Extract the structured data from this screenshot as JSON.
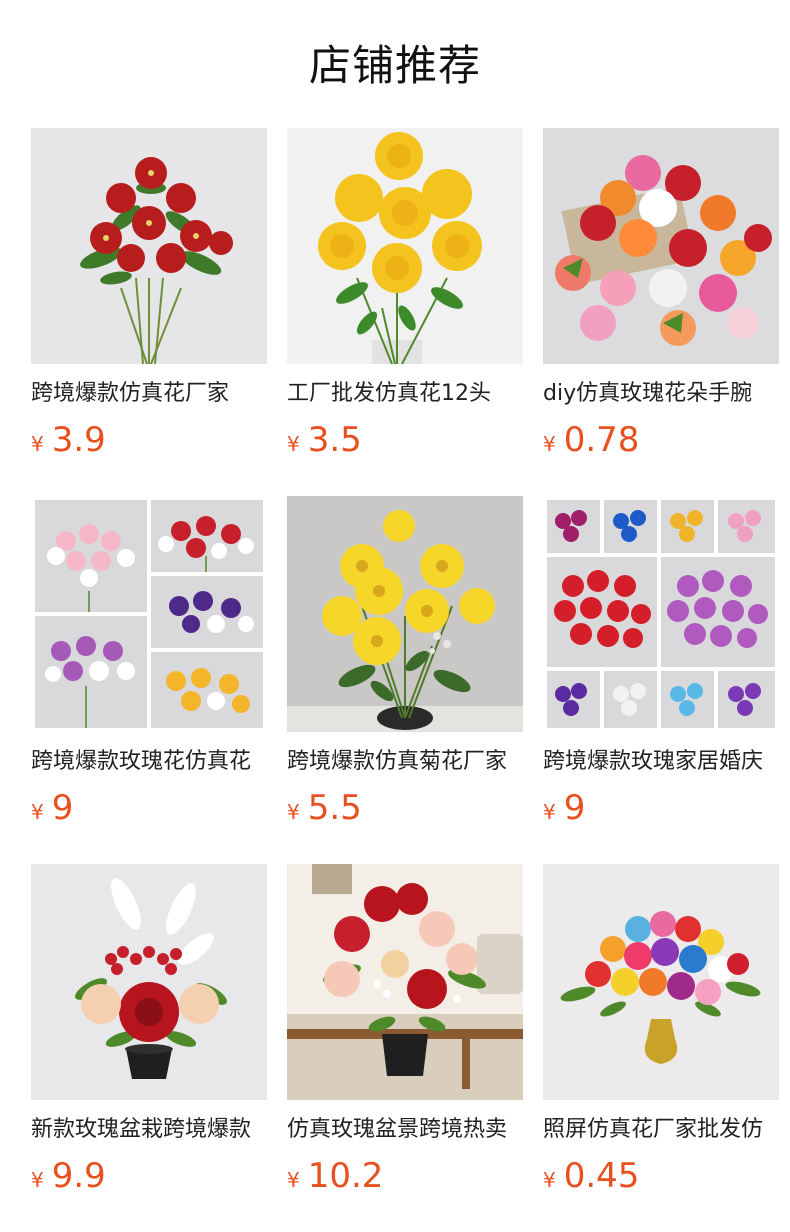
{
  "page": {
    "title": "店铺推荐"
  },
  "theme": {
    "price_color": "#e8501f",
    "text_color": "#222222"
  },
  "products": [
    {
      "name": "跨境爆款仿真花厂家",
      "currency": "¥",
      "price": "3.9",
      "image": "red-lily-bouquet"
    },
    {
      "name": "工厂批发仿真花12头",
      "currency": "¥",
      "price": "3.5",
      "image": "yellow-carnation-bouquet"
    },
    {
      "name": "diy仿真玫瑰花朵手腕",
      "currency": "¥",
      "price": "0.78",
      "image": "rose-heads-assortment"
    },
    {
      "name": "跨境爆款玫瑰花仿真花",
      "currency": "¥",
      "price": "9",
      "image": "rose-bouquet-collage"
    },
    {
      "name": "跨境爆款仿真菊花厂家",
      "currency": "¥",
      "price": "5.5",
      "image": "yellow-gerbera-bouquet"
    },
    {
      "name": "跨境爆款玫瑰家居婚庆",
      "currency": "¥",
      "price": "9",
      "image": "rose-color-grid"
    },
    {
      "name": "新款玫瑰盆栽跨境爆款",
      "currency": "¥",
      "price": "9.9",
      "image": "potted-rose-arrangement"
    },
    {
      "name": "仿真玫瑰盆景跨境热卖",
      "currency": "¥",
      "price": "10.2",
      "image": "potted-rose-living-room"
    },
    {
      "name": "照屏仿真花厂家批发仿",
      "currency": "¥",
      "price": "0.45",
      "image": "rainbow-rose-vase"
    }
  ]
}
